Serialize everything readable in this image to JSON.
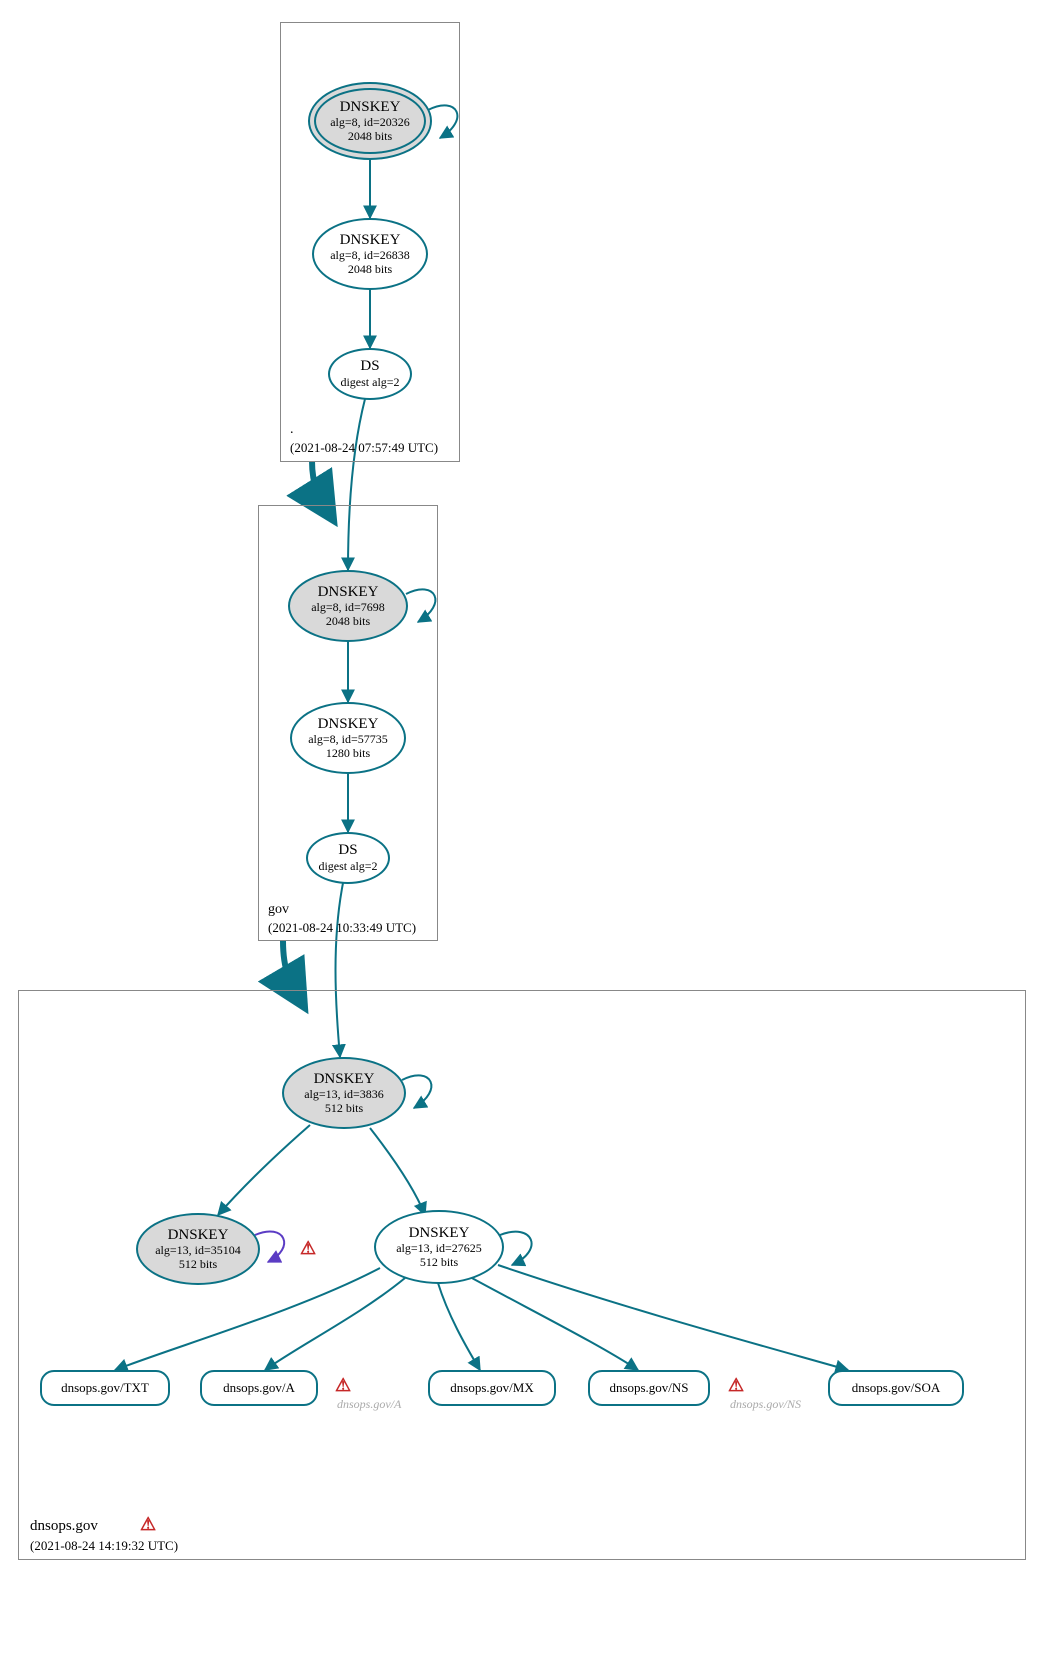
{
  "color_teal": "#0b7285",
  "color_gray_fill": "#d9d9d9",
  "color_purple": "#5b3cc4",
  "zones": {
    "root": {
      "label": ".",
      "timestamp": "(2021-08-24 07:57:49 UTC)",
      "nodes": {
        "ksk": {
          "title": "DNSKEY",
          "detail": "alg=8, id=20326",
          "bits": "2048 bits"
        },
        "zsk": {
          "title": "DNSKEY",
          "detail": "alg=8, id=26838",
          "bits": "2048 bits"
        },
        "ds": {
          "title": "DS",
          "detail": "digest alg=2"
        }
      }
    },
    "gov": {
      "label": "gov",
      "timestamp": "(2021-08-24 10:33:49 UTC)",
      "nodes": {
        "ksk": {
          "title": "DNSKEY",
          "detail": "alg=8, id=7698",
          "bits": "2048 bits"
        },
        "zsk": {
          "title": "DNSKEY",
          "detail": "alg=8, id=57735",
          "bits": "1280 bits"
        },
        "ds": {
          "title": "DS",
          "detail": "digest alg=2"
        }
      }
    },
    "dnsops": {
      "label": "dnsops.gov",
      "timestamp": "(2021-08-24 14:19:32 UTC)",
      "nodes": {
        "ksk": {
          "title": "DNSKEY",
          "detail": "alg=13, id=3836",
          "bits": "512 bits"
        },
        "key2": {
          "title": "DNSKEY",
          "detail": "alg=13, id=35104",
          "bits": "512 bits"
        },
        "zsk": {
          "title": "DNSKEY",
          "detail": "alg=13, id=27625",
          "bits": "512 bits"
        }
      },
      "rrsets": {
        "txt": "dnsops.gov/TXT",
        "a": "dnsops.gov/A",
        "mx": "dnsops.gov/MX",
        "ns": "dnsops.gov/NS",
        "soa": "dnsops.gov/SOA"
      },
      "warnings": {
        "key2": "",
        "a": "dnsops.gov/A",
        "ns": "dnsops.gov/NS",
        "domain": ""
      }
    }
  }
}
